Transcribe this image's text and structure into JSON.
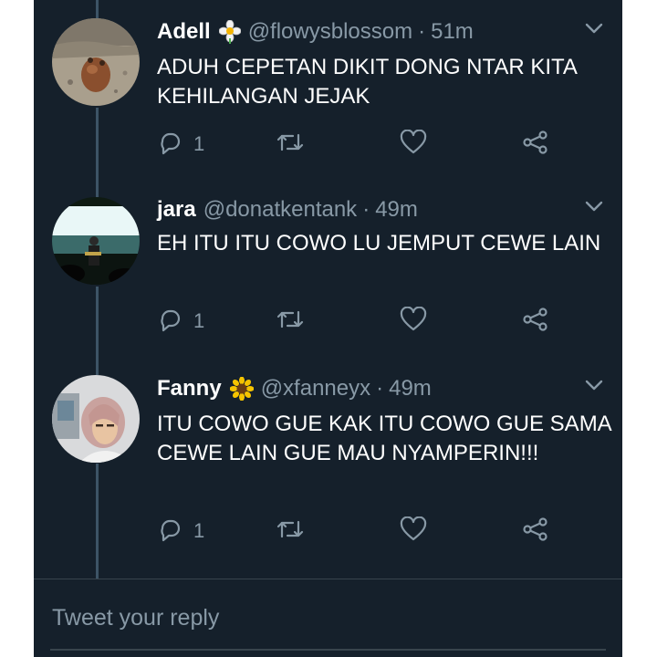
{
  "tweets": [
    {
      "name": "Adell",
      "emoji": "white-flower",
      "handle": "@flowysblossom",
      "time": "51m",
      "text": "ADUH CEPETAN DIKIT DONG NTAR KITA KEHILANGAN JEJAK",
      "reply_count": "1"
    },
    {
      "name": "jara",
      "handle": "@donatkentank",
      "time": "49m",
      "text": "EH ITU ITU COWO LU JEMPUT CEWE LAIN",
      "reply_count": "1"
    },
    {
      "name": "Fanny",
      "emoji": "sunflower",
      "handle": "@xfanneyx",
      "time": "49m",
      "text": "ITU COWO GUE KAK ITU COWO GUE SAMA CEWE LAIN GUE MAU NYAMPERIN!!!",
      "reply_count": "1"
    }
  ],
  "separator": "·",
  "reply_placeholder": "Tweet your reply",
  "icons": [
    "reply-icon",
    "retweet-icon",
    "like-icon",
    "share-icon",
    "chevron-down-icon"
  ],
  "colors": {
    "background": "#15202b",
    "text": "#ffffff",
    "muted": "#8899a6",
    "line": "#3d5466"
  }
}
